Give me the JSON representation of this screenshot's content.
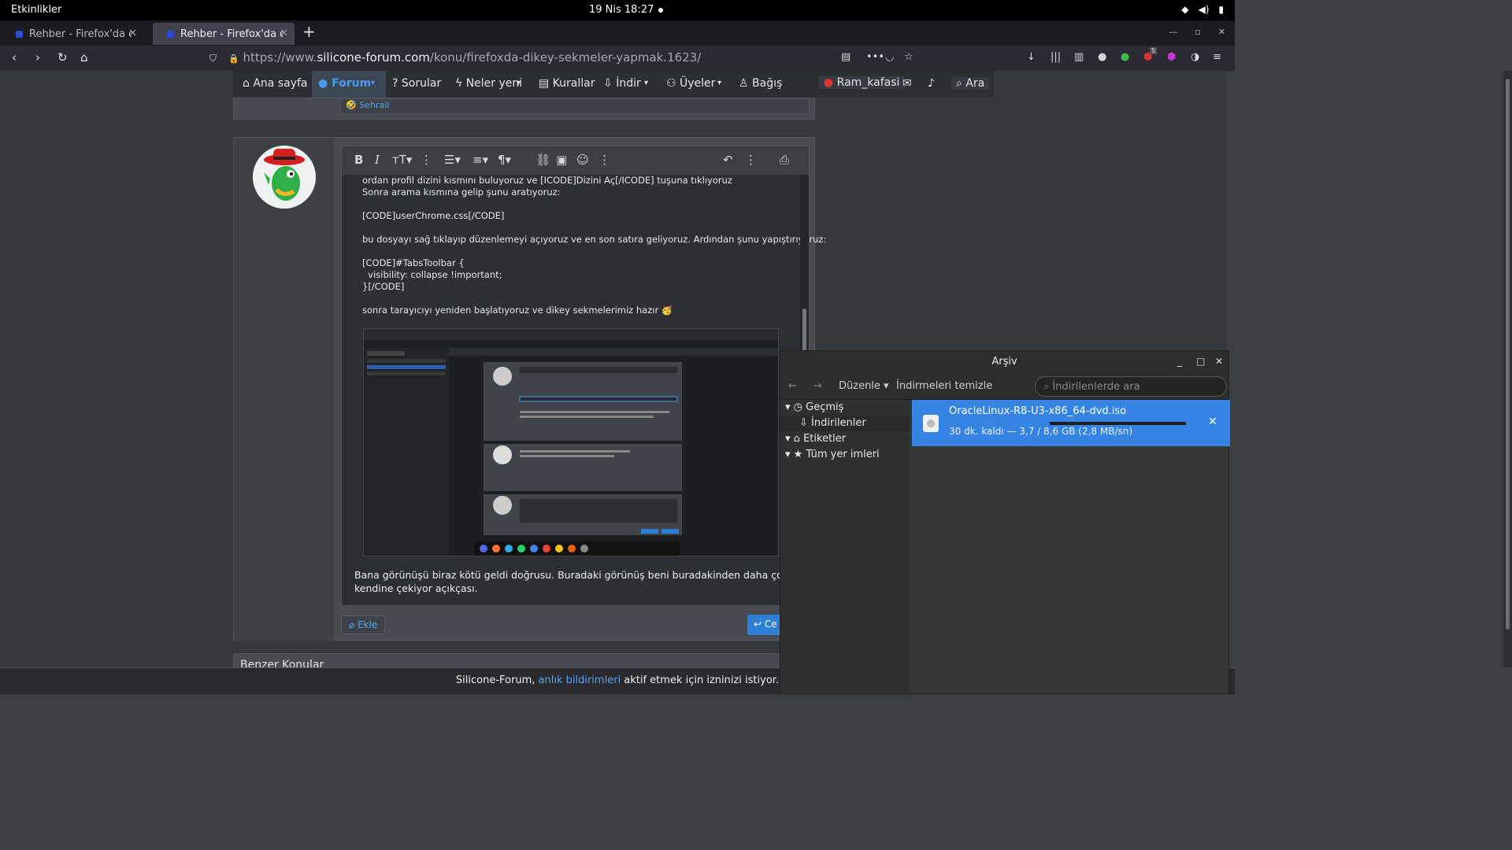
{
  "system": {
    "activities": "Etkinlikler",
    "clock": "19 Nis  18:27"
  },
  "tabs": [
    {
      "label": "Rehber - Firefox'da d"
    },
    {
      "label": "Rehber - Firefox'da d"
    }
  ],
  "address": {
    "prefix": "https://www.",
    "host": "silicone-forum.com",
    "path": "/konu/firefoxda-dikey-sekmeler-yapmak.1623/"
  },
  "forum_nav": {
    "home": "Ana sayfa",
    "forum": "Forum",
    "questions": "Sorular",
    "whats_new": "Neler yeni",
    "rules": "Kurallar",
    "download": "İndir",
    "members": "Üyeler",
    "donate": "Bağış",
    "user": "Ram_kafasi",
    "search": "Ara"
  },
  "prev_post": {
    "author_link": "Sehrail"
  },
  "editor": {
    "lines": [
      "ordan profil dizini kısmını buluyoruz ve [ICODE]Dizini Aç[/ICODE] tuşuna tıklıyoruz",
      "Sonra arama kısmına gelip şunu aratıyoruz:",
      "",
      "[CODE]userChrome.css[/CODE]",
      "",
      "bu dosyayı sağ tıklayıp düzenlemeyi açıyoruz ve en son satıra geliyoruz. Ardından şunu yapıştırıyoruz:",
      "",
      "[CODE]#TabsToolbar {",
      "  visibility: collapse !important;",
      "}[/CODE]",
      "",
      "sonra tarayıcıyı yeniden başlatıyoruz ve dikey sekmelerimiz hazır 🥳"
    ],
    "reply_text": "Bana görünüşü biraz kötü geldi doğrusu. Buradaki görünüş beni buradakinden daha çok kendine çekiyor açıkçası."
  },
  "buttons": {
    "attach": "Ekle",
    "reply": "Ce"
  },
  "similar_threads": "Benzer Konular",
  "notification": {
    "before": "Silicone-Forum, ",
    "link": "anlık bildirimleri",
    "after": " aktif etmek için izninizi istiyor."
  },
  "library": {
    "title": "Arşiv",
    "organize": "Düzenle",
    "clear_downloads": "İndirmeleri temizle",
    "search_placeholder": "İndirilenlerde ara",
    "tree": [
      {
        "label": "Geçmiş"
      },
      {
        "label": "İndirilenler"
      },
      {
        "label": "Etiketler"
      },
      {
        "label": "Tüm yer imleri"
      }
    ],
    "download": {
      "filename": "OracleLinux-R8-U3-x86_64-dvd.iso",
      "status": "30 dk. kaldı — 3,7 / 8,6 GB (2,8 MB/sn)",
      "progress": 0.43
    }
  },
  "toolbar_badge": "5",
  "colors": {
    "accent": "#3584e4",
    "link": "#5aa2ec",
    "forum_active": "#4a9af0"
  }
}
